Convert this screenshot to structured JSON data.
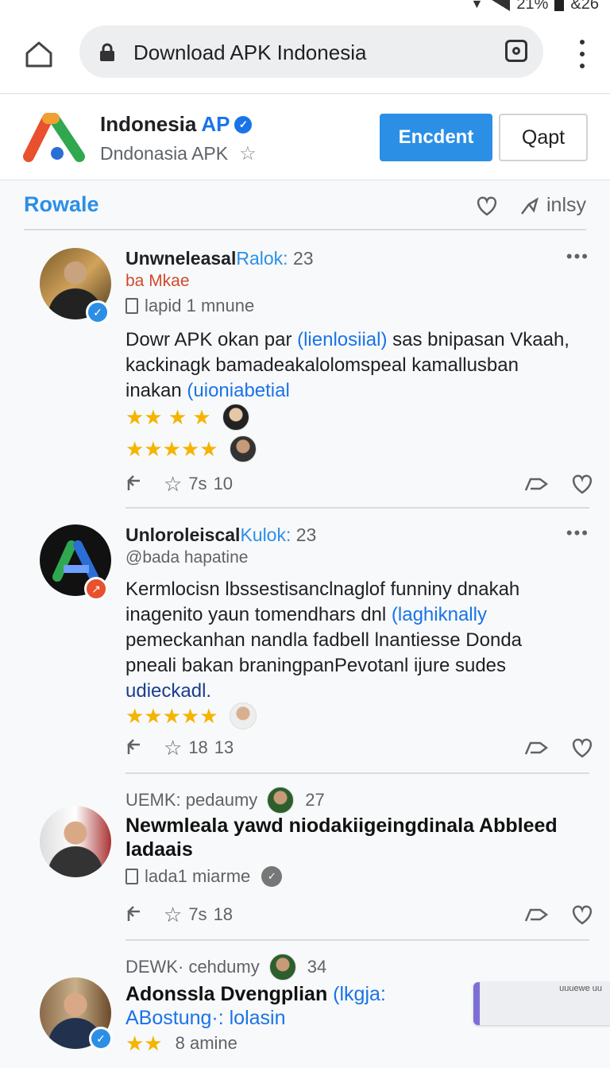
{
  "status": {
    "battery": "21%",
    "time": "&26"
  },
  "browser": {
    "url": "Download APK Indonesia"
  },
  "app": {
    "name_main": "Indonesia",
    "name_accent": "AP",
    "subtitle": "Dndonasia APK",
    "primary_button": "Encdent",
    "secondary_button": "Qapt",
    "logo_colors": {
      "orange": "#e8502e",
      "green": "#2fa84f",
      "blue": "#2b6fd6"
    }
  },
  "section": {
    "title": "Rowale",
    "share_label": "inlsy"
  },
  "posts": [
    {
      "user": "Unwneleasal",
      "user_accent": "Ralok:",
      "user_num": "23",
      "handle": "ba Mkae",
      "meta": "lapid 1 mnune",
      "body_pre": "Dowr APK okan par ",
      "body_link": "(lienlosiial)",
      "body_mid": " sas bnipasan Vkaah, kackinagk bamadeakalolomspeal kamallusban inakan ",
      "body_link2": "(uioniabetial",
      "rating1": "★★ ★ ★",
      "rating2": "★★★★★",
      "likes": "7s",
      "count": "10"
    },
    {
      "user": "Unloroleiscal",
      "user_accent": "Kulok:",
      "user_num": "23",
      "handle": "@bada hapatine",
      "body_pre": "Kermlocisn lbssestisanclnaglof funniny dnakah inagenito yaun tomendhars dnl ",
      "body_link": "(laghiknally",
      "body_mid": " pemeckanhan nandla fadbell lnantiesse Donda pneali bakan braningpanPevotanl ijure sudes ",
      "body_link2": "udieckadl.",
      "rating1": "★★★★★",
      "likes": "18",
      "count": "13"
    },
    {
      "meta_line": "UEMK: pedaumy",
      "meta_num": "27",
      "headline": "Newmleala yawd niodakiigeingdinala Abbleed ladaais",
      "meta": "lada1 miarme",
      "likes": "7s",
      "count": "18"
    },
    {
      "meta_line": "DEWK· cehdumy",
      "meta_num": "34",
      "headline": "Adonssla Dvengplian ",
      "headline_link": "(lkgja: ABostung·: lolasin",
      "rating": "★★",
      "meta": "8 amine"
    }
  ],
  "toast": {
    "text": "uuuewe uu"
  }
}
